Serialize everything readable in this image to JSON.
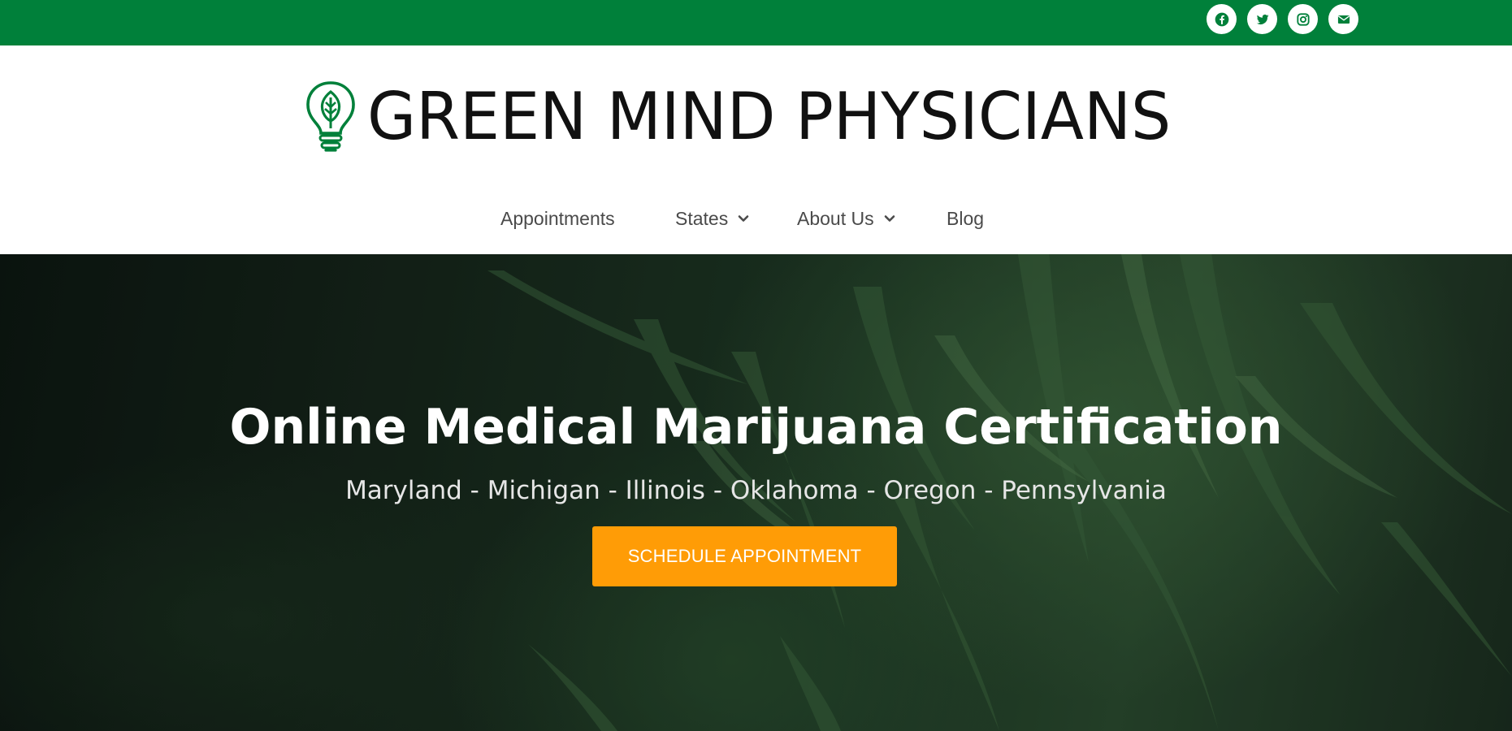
{
  "topbar": {
    "background": "#00803a",
    "social": [
      {
        "icon": "facebook-icon",
        "label": "Facebook"
      },
      {
        "icon": "twitter-icon",
        "label": "Twitter"
      },
      {
        "icon": "instagram-icon",
        "label": "Instagram"
      },
      {
        "icon": "envelope-icon",
        "label": "Email"
      }
    ]
  },
  "header": {
    "logo_text": "GREEN MIND PHYSICIANS",
    "logo_icon": "lightbulb-leaf-icon",
    "brand_color": "#00803a"
  },
  "nav": {
    "items": [
      {
        "label": "Appointments",
        "has_dropdown": false
      },
      {
        "label": "States",
        "has_dropdown": true
      },
      {
        "label": "About Us",
        "has_dropdown": true
      },
      {
        "label": "Blog",
        "has_dropdown": false
      }
    ]
  },
  "hero": {
    "title": "Online Medical Marijuana Certification",
    "subtitle": "Maryland - Michigan - Illinois - Oklahoma - Oregon - Pennsylvania",
    "cta_label": "SCHEDULE APPOINTMENT",
    "cta_color": "#ff9c06"
  }
}
